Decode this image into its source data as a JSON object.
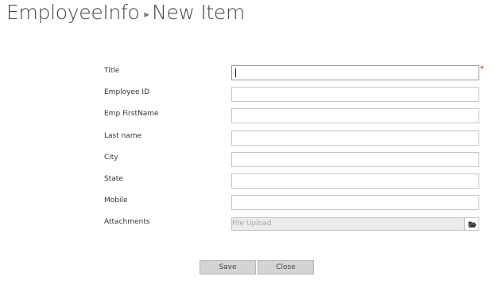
{
  "header": {
    "list_name": "EmployeeInfo",
    "separator": "▸",
    "item_name": "New Item"
  },
  "form": {
    "fields": [
      {
        "label": "Title",
        "value": "",
        "required": true,
        "required_marker": "*"
      },
      {
        "label": "Employee ID",
        "value": ""
      },
      {
        "label": "Emp FirstName",
        "value": ""
      },
      {
        "label": "Last name",
        "value": ""
      },
      {
        "label": "City",
        "value": ""
      },
      {
        "label": "State",
        "value": ""
      },
      {
        "label": "Mobile",
        "value": ""
      }
    ],
    "attachments": {
      "label": "Attachments",
      "placeholder": "File Upload",
      "browse_icon": "folder-open-icon"
    }
  },
  "actions": {
    "save_label": "Save",
    "close_label": "Close"
  },
  "colors": {
    "required": "#bf0000",
    "button_bg": "#d4d4d4",
    "upload_bg": "#ebebeb",
    "input_border": "#c6c6c6"
  }
}
